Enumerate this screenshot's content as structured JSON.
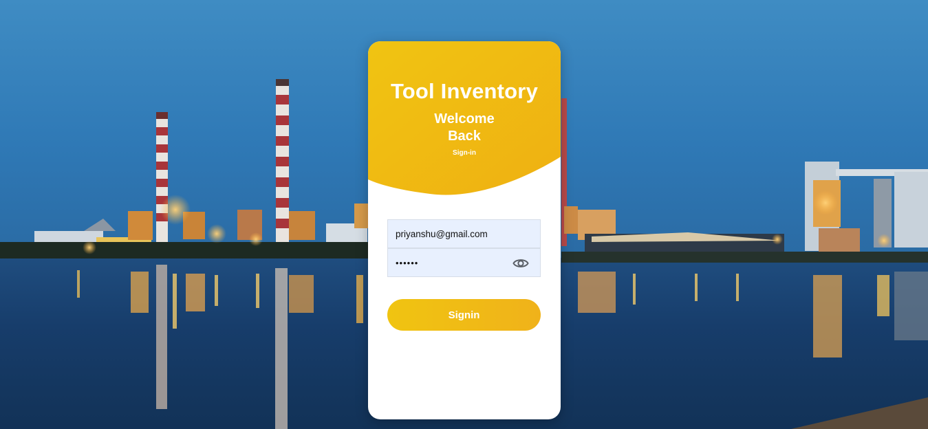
{
  "login": {
    "app_title": "Tool Inventory",
    "welcome_line1": "Welcome",
    "welcome_line2": "Back",
    "subtitle": "Sign-in",
    "email": {
      "value": "priyanshu@gmail.com"
    },
    "password": {
      "value": "••••••"
    },
    "password_toggle_icon": "eye-icon",
    "submit_label": "Signin"
  },
  "colors": {
    "accent": "#f0b515",
    "card_background": "#ffffff",
    "input_background": "#e8f0fe"
  }
}
